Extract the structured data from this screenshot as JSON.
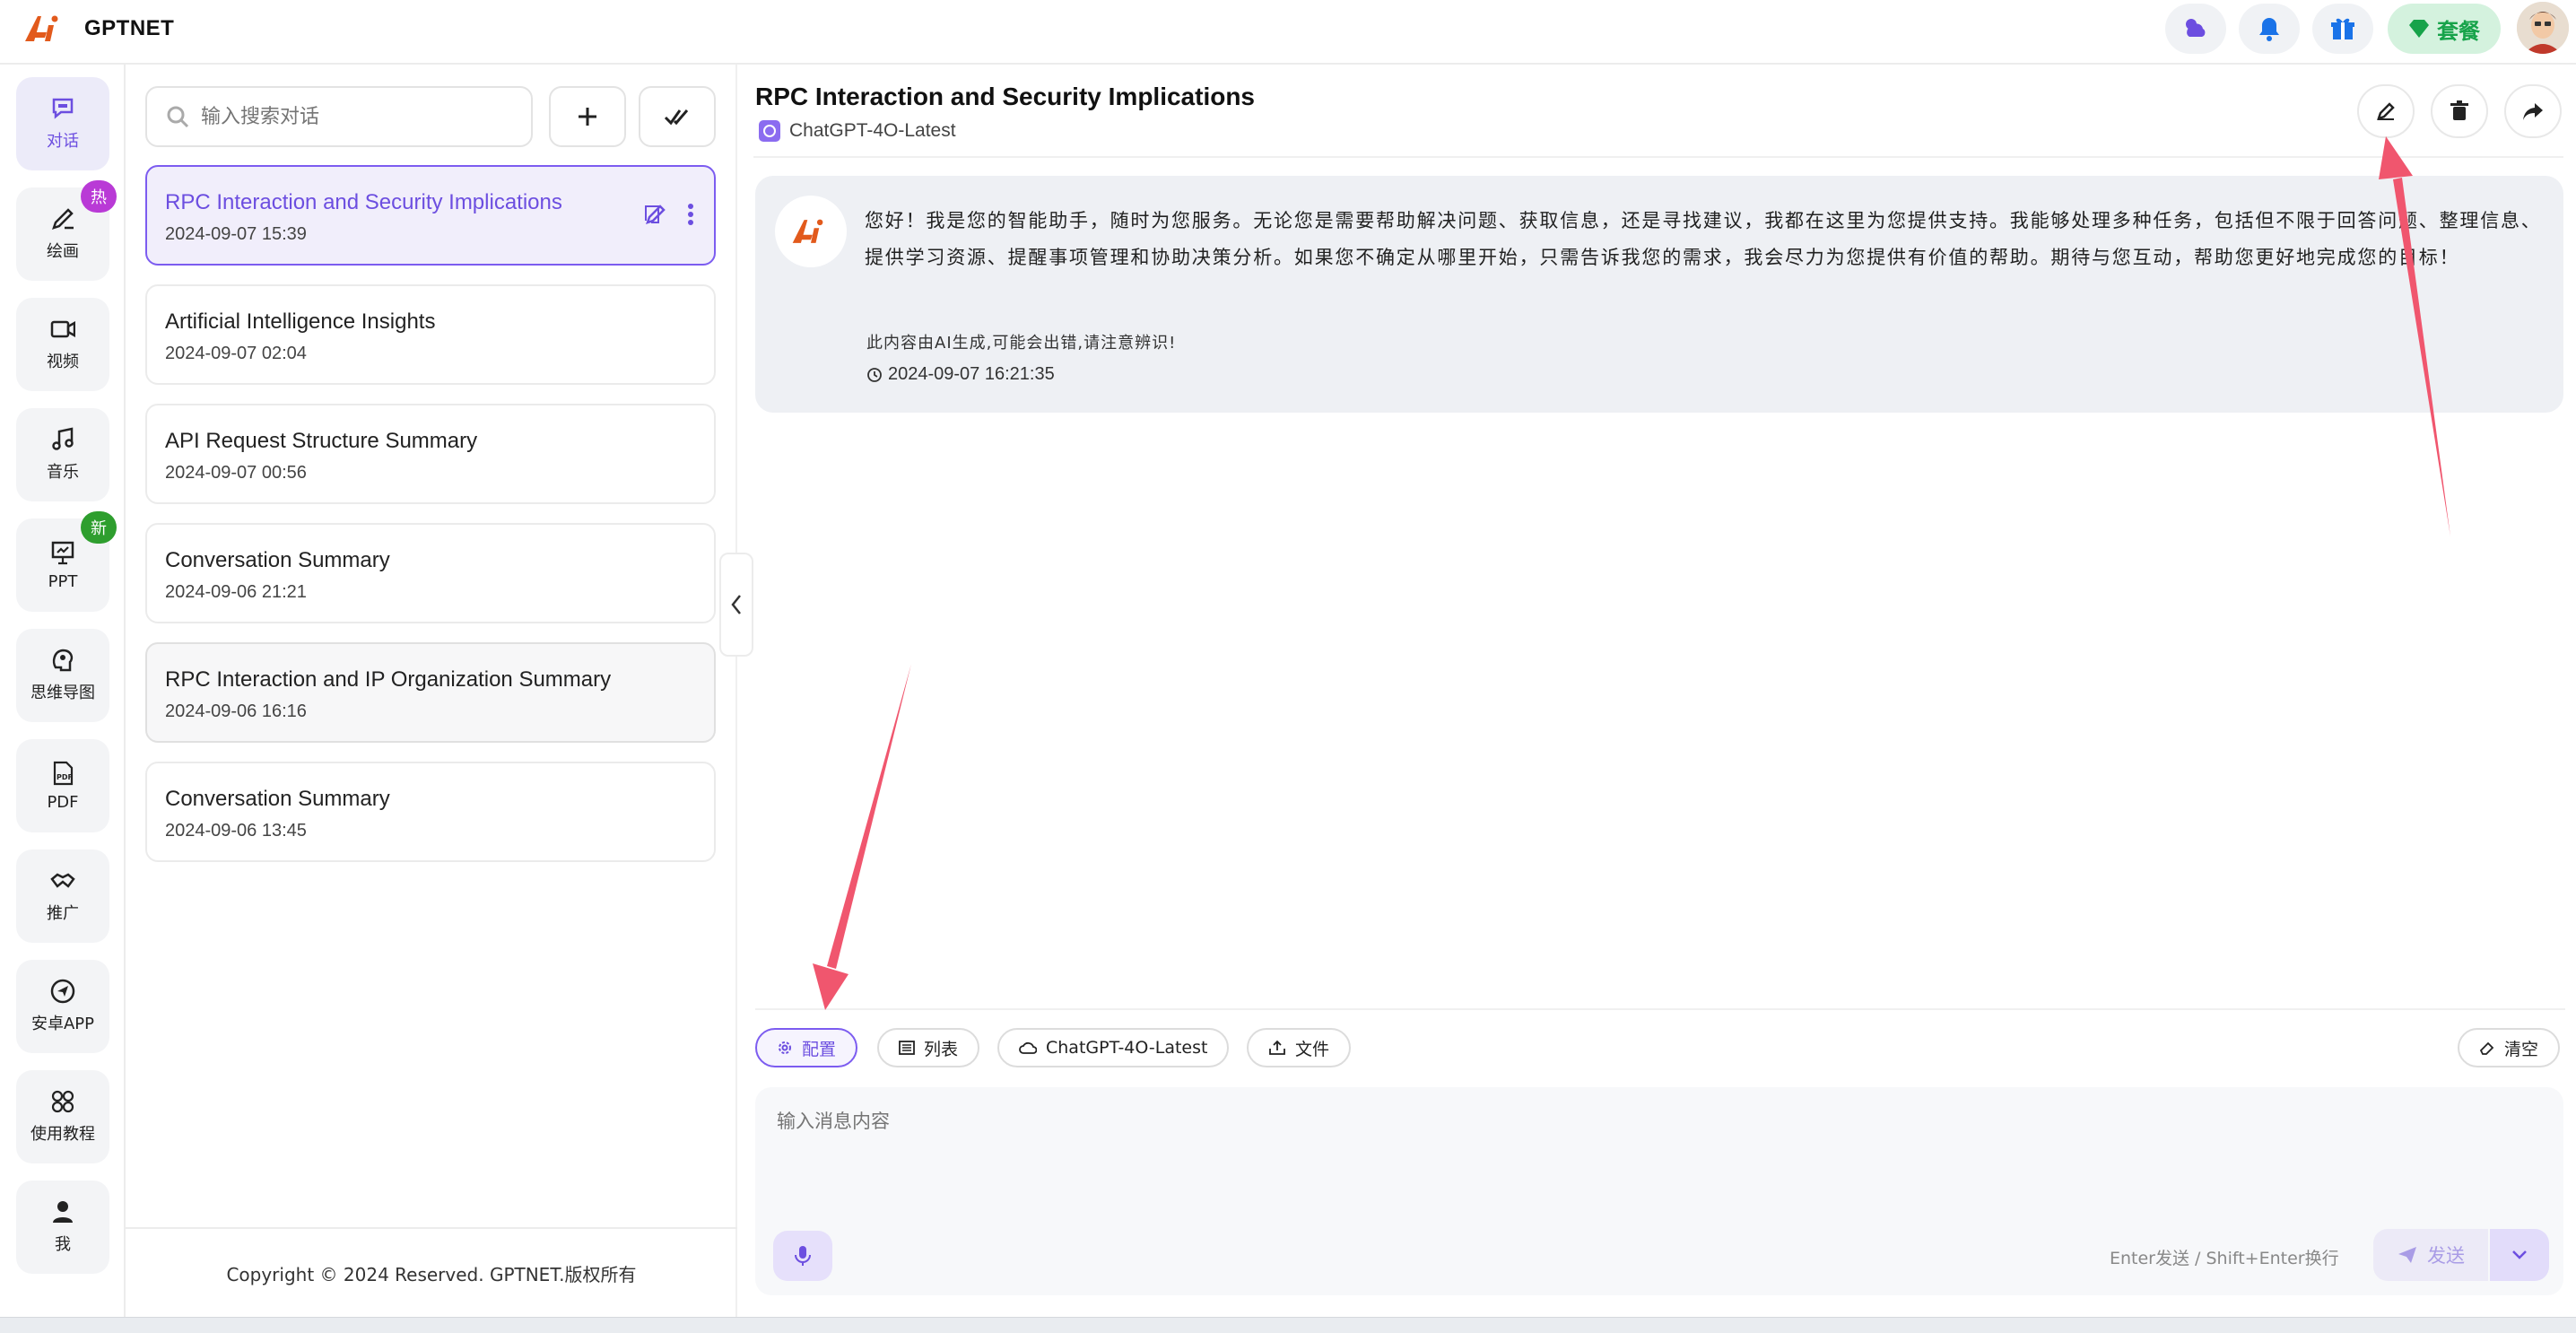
{
  "app": {
    "title": "GPTNET",
    "logo_text": "Ai"
  },
  "topbar": {
    "icons": [
      "weather-icon",
      "bell-icon",
      "gift-icon"
    ],
    "package_label": "套餐"
  },
  "nav": [
    {
      "label": "对话",
      "icon": "chat-icon",
      "active": true
    },
    {
      "label": "绘画",
      "icon": "paint-icon",
      "badge": "热",
      "badge_color": "#b93ad6"
    },
    {
      "label": "视频",
      "icon": "video-icon"
    },
    {
      "label": "音乐",
      "icon": "music-icon"
    },
    {
      "label": "PPT",
      "icon": "presentation-icon",
      "badge": "新",
      "badge_color": "#2e9e2e"
    },
    {
      "label": "思维导图",
      "icon": "mindmap-icon"
    },
    {
      "label": "PDF",
      "icon": "pdf-icon"
    },
    {
      "label": "推广",
      "icon": "handshake-icon"
    },
    {
      "label": "安卓APP",
      "icon": "send-icon"
    },
    {
      "label": "使用教程",
      "icon": "grid-icon"
    },
    {
      "label": "我",
      "icon": "user-icon"
    }
  ],
  "search": {
    "placeholder": "输入搜索对话"
  },
  "conversations": [
    {
      "title": "RPC Interaction and Security Implications",
      "date": "2024-09-07 15:39",
      "active": true
    },
    {
      "title": "Artificial Intelligence Insights",
      "date": "2024-09-07 02:04"
    },
    {
      "title": "API Request Structure Summary",
      "date": "2024-09-07 00:56"
    },
    {
      "title": "Conversation Summary",
      "date": "2024-09-06 21:21"
    },
    {
      "title": "RPC Interaction and IP Organization Summary",
      "date": "2024-09-06 16:16",
      "hover": true
    },
    {
      "title": "Conversation Summary",
      "date": "2024-09-06 13:45"
    }
  ],
  "footer": {
    "copyright": "Copyright © 2024 Reserved. GPTNET.版权所有"
  },
  "chat": {
    "title": "RPC Interaction and Security Implications",
    "model": "ChatGPT-4O-Latest",
    "message": {
      "text": "您好！我是您的智能助手，随时为您服务。无论您是需要帮助解决问题、获取信息，还是寻找建议，我都在这里为您提供支持。我能够处理多种任务，包括但不限于回答问题、整理信息、提供学习资源、提醒事项管理和协助决策分析。如果您不确定从哪里开始，只需告诉我您的需求，我会尽力为您提供有价值的帮助。期待与您互动，帮助您更好地完成您的目标！",
      "note": "此内容由AI生成,可能会出错,请注意辨识!",
      "time": "2024-09-07 16:21:35"
    }
  },
  "toolbar": {
    "config_label": "配置",
    "list_label": "列表",
    "model_label": "ChatGPT-4O-Latest",
    "file_label": "文件",
    "clear_label": "清空"
  },
  "composer": {
    "placeholder": "输入消息内容",
    "hint": "Enter发送 / Shift+Enter换行",
    "send_label": "发送"
  },
  "colors": {
    "accent": "#6c4ee0",
    "arrow": "#f0566e",
    "logo": "#e25a1c"
  }
}
